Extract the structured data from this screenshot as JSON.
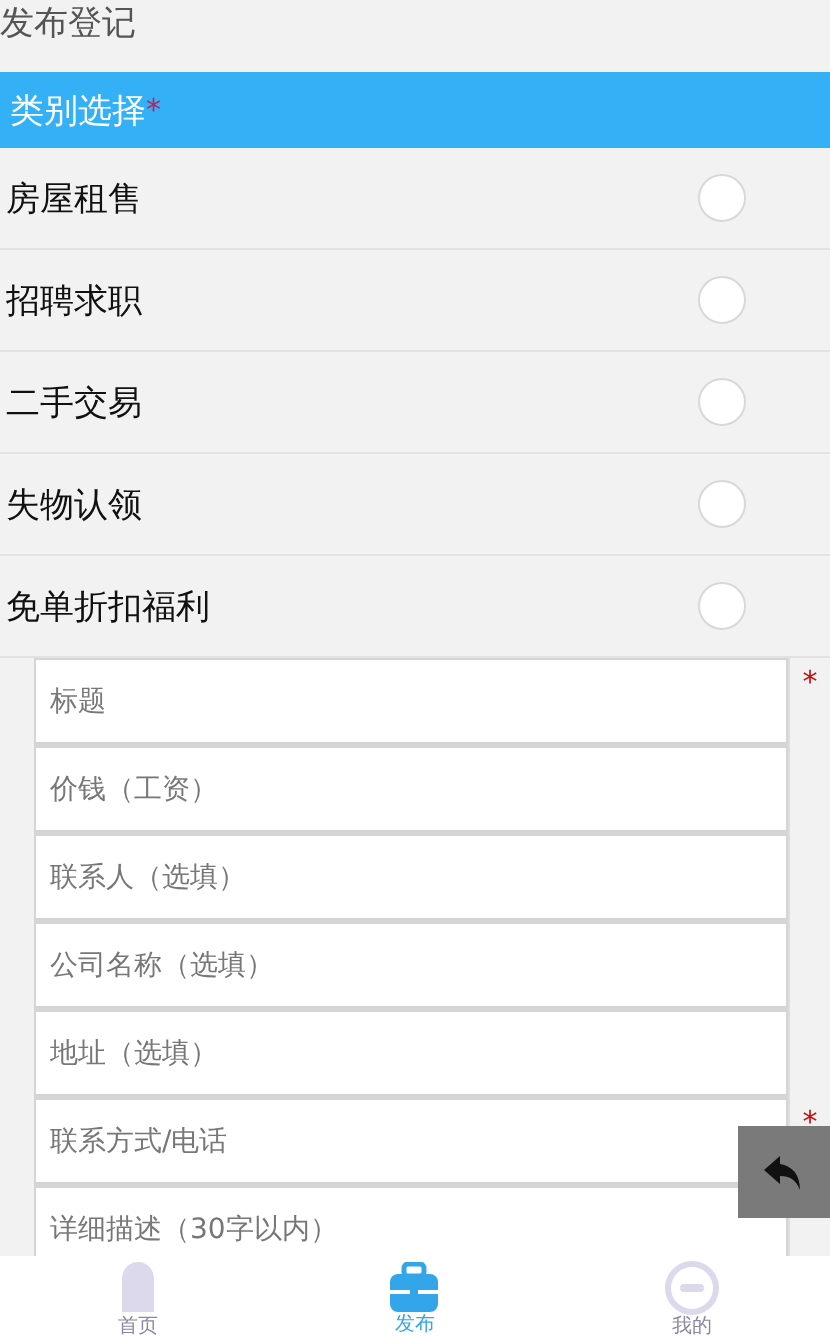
{
  "header": {
    "title": "发布登记"
  },
  "category": {
    "title": "类别选择",
    "required_mark": "*",
    "options": [
      {
        "label": "房屋租售",
        "selected": false
      },
      {
        "label": "招聘求职",
        "selected": false
      },
      {
        "label": "二手交易",
        "selected": false
      },
      {
        "label": "失物认领",
        "selected": false
      },
      {
        "label": "免单折扣福利",
        "selected": false
      }
    ]
  },
  "fields": [
    {
      "placeholder": "标题",
      "required": true
    },
    {
      "placeholder": "价钱（工资）",
      "required": false
    },
    {
      "placeholder": "联系人（选填）",
      "required": false
    },
    {
      "placeholder": "公司名称（选填）",
      "required": false
    },
    {
      "placeholder": "地址（选填）",
      "required": false
    },
    {
      "placeholder": "联系方式/电话",
      "required": true
    },
    {
      "placeholder": "详细描述（30字以内）"
    }
  ],
  "required_mark": "*",
  "tabs": [
    {
      "label": "首页",
      "kind": "home",
      "selected": false
    },
    {
      "label": "发布",
      "kind": "publish",
      "selected": true
    },
    {
      "label": "我的",
      "kind": "mine",
      "selected": false
    }
  ]
}
